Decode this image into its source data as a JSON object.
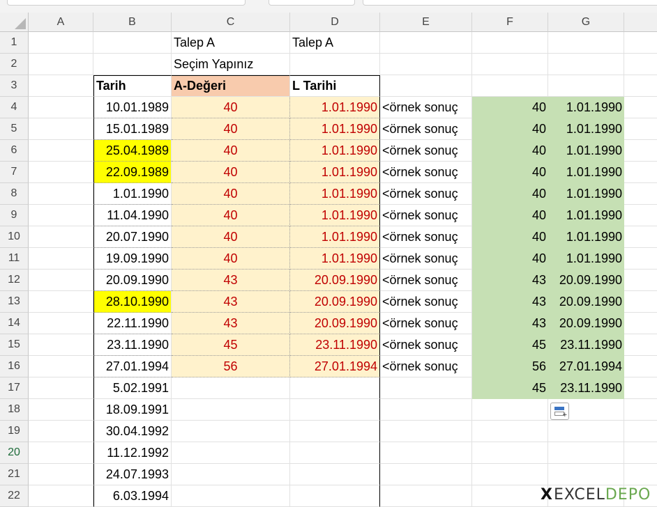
{
  "columns": [
    "A",
    "B",
    "C",
    "D",
    "E",
    "F",
    "G"
  ],
  "rows": [
    "1",
    "2",
    "3",
    "4",
    "5",
    "6",
    "7",
    "8",
    "9",
    "10",
    "11",
    "12",
    "13",
    "14",
    "15",
    "16",
    "17",
    "18",
    "19",
    "20",
    "21",
    "22"
  ],
  "selected_row": "20",
  "header_cells": {
    "c1": "Talep A",
    "d1": "Talep A",
    "c2": "Seçim Yapınız",
    "b3": "Tarih",
    "c3": "A-Değeri",
    "d3": "L Tarihi"
  },
  "dates": [
    "10.01.1989",
    "15.01.1989",
    "25.04.1989",
    "22.09.1989",
    "1.01.1990",
    "11.04.1990",
    "20.07.1990",
    "19.09.1990",
    "20.09.1990",
    "28.10.1990",
    "22.11.1990",
    "23.11.1990",
    "27.01.1994",
    "5.02.1991",
    "18.09.1991",
    "30.04.1992",
    "11.12.1992",
    "24.07.1993",
    "6.03.1994"
  ],
  "highlighted_date_rows": [
    "6",
    "7",
    "13"
  ],
  "a_values": [
    "40",
    "40",
    "40",
    "40",
    "40",
    "40",
    "40",
    "40",
    "43",
    "43",
    "43",
    "45",
    "56"
  ],
  "l_dates": [
    "1.01.1990",
    "1.01.1990",
    "1.01.1990",
    "1.01.1990",
    "1.01.1990",
    "1.01.1990",
    "1.01.1990",
    "1.01.1990",
    "20.09.1990",
    "20.09.1990",
    "20.09.1990",
    "23.11.1990",
    "27.01.1994"
  ],
  "sample_label": "<örnek sonuç",
  "result_f": [
    "40",
    "40",
    "40",
    "40",
    "40",
    "40",
    "40",
    "40",
    "43",
    "43",
    "43",
    "45",
    "56",
    "45"
  ],
  "result_g": [
    "1.01.1990",
    "1.01.1990",
    "1.01.1990",
    "1.01.1990",
    "1.01.1990",
    "1.01.1990",
    "1.01.1990",
    "1.01.1990",
    "20.09.1990",
    "20.09.1990",
    "20.09.1990",
    "23.11.1990",
    "27.01.1994",
    "23.11.1990"
  ],
  "logo": {
    "mark": "X",
    "part1": "EXCEL",
    "part2": "DEPO"
  },
  "colors": {
    "cream": "#fff2cc",
    "salmon": "#f8cbad",
    "green": "#c6e0b4",
    "yellow": "#ffff00",
    "red_text": "#c00000",
    "logo_green": "#6aa84f"
  },
  "icons": {
    "quick_analysis": "quick-analysis-icon",
    "select_all": "select-all-icon"
  }
}
